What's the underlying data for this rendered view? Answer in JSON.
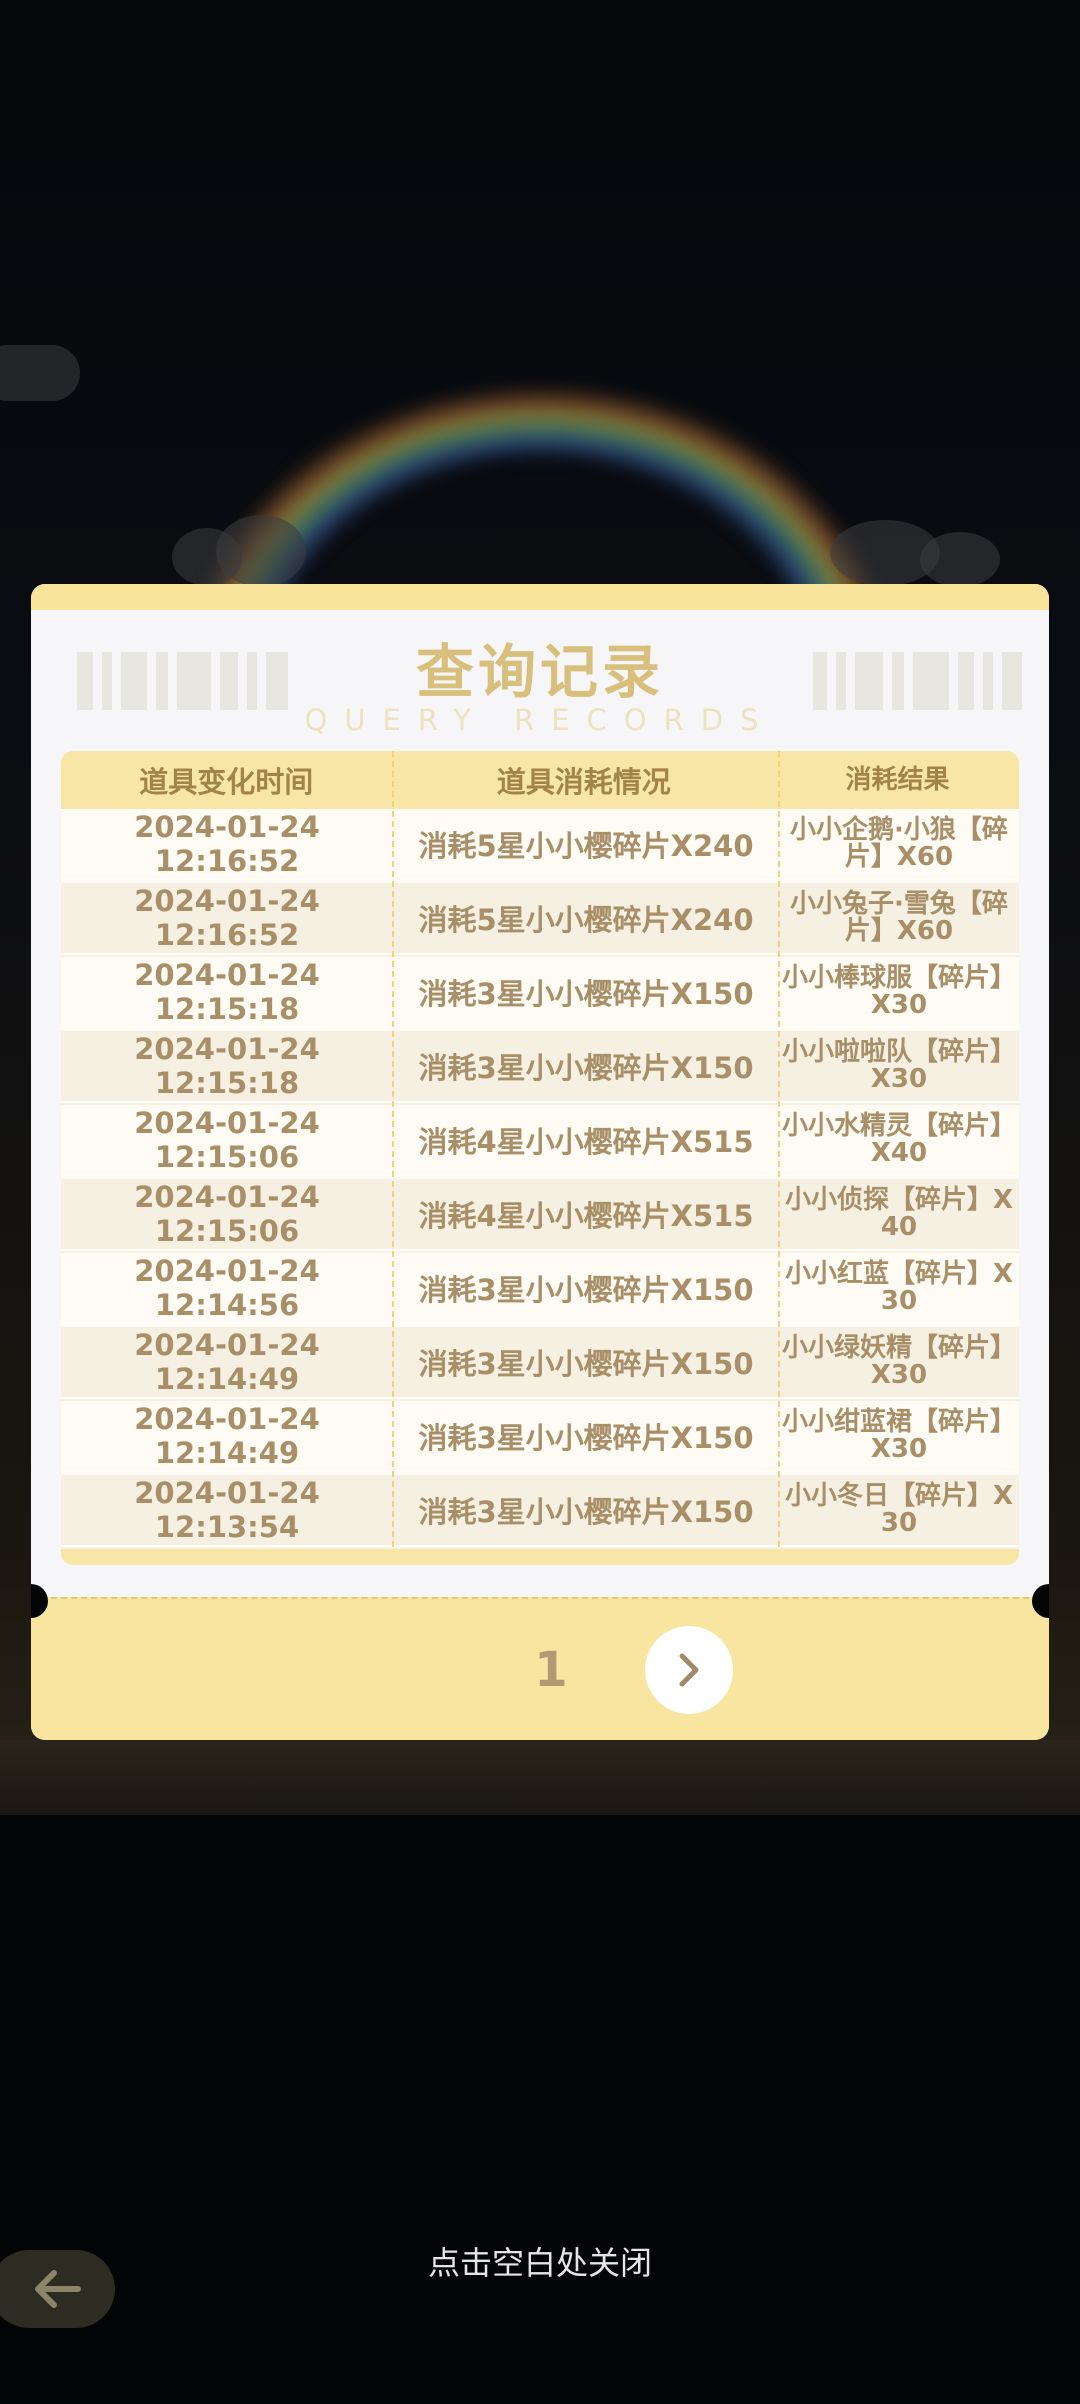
{
  "modal": {
    "title": "查询记录",
    "subtitle": "QUERY RECORDS",
    "headers": [
      "道具变化时间",
      "道具消耗情况",
      "消耗结果"
    ],
    "rows": [
      {
        "time": "2024-01-24 12:16:52",
        "consumption": "消耗5星小小樱碎片X240",
        "result": "小小企鹅·小狼【碎片】X60"
      },
      {
        "time": "2024-01-24 12:16:52",
        "consumption": "消耗5星小小樱碎片X240",
        "result": "小小兔子·雪兔【碎片】X60"
      },
      {
        "time": "2024-01-24 12:15:18",
        "consumption": "消耗3星小小樱碎片X150",
        "result": "小小棒球服【碎片】X30"
      },
      {
        "time": "2024-01-24 12:15:18",
        "consumption": "消耗3星小小樱碎片X150",
        "result": "小小啦啦队【碎片】X30"
      },
      {
        "time": "2024-01-24 12:15:06",
        "consumption": "消耗4星小小樱碎片X515",
        "result": "小小水精灵【碎片】X40"
      },
      {
        "time": "2024-01-24 12:15:06",
        "consumption": "消耗4星小小樱碎片X515",
        "result": "小小侦探【碎片】X40"
      },
      {
        "time": "2024-01-24 12:14:56",
        "consumption": "消耗3星小小樱碎片X150",
        "result": "小小红蓝【碎片】X30"
      },
      {
        "time": "2024-01-24 12:14:49",
        "consumption": "消耗3星小小樱碎片X150",
        "result": "小小绿妖精【碎片】X30"
      },
      {
        "time": "2024-01-24 12:14:49",
        "consumption": "消耗3星小小樱碎片X150",
        "result": "小小绀蓝裙【碎片】X30"
      },
      {
        "time": "2024-01-24 12:13:54",
        "consumption": "消耗3星小小樱碎片X150",
        "result": "小小冬日【碎片】X30"
      }
    ],
    "pagination": {
      "current_page": "1"
    }
  },
  "close_hint": "点击空白处关闭",
  "icons": {
    "next": "chevron-right-icon",
    "back": "back-arrow-icon"
  },
  "colors": {
    "accent": "#f8e39a",
    "text": "#a88f68",
    "title": "#d8c07c"
  }
}
